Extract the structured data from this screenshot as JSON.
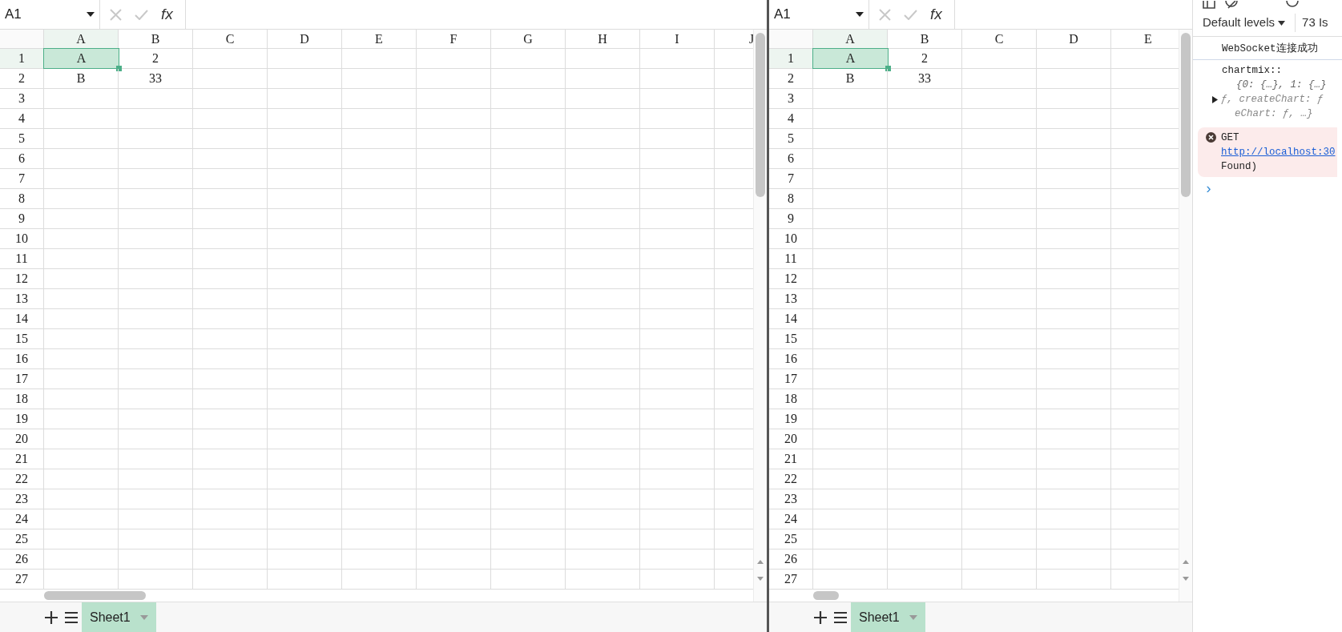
{
  "panes": [
    {
      "name_box": "A1",
      "function_label": "fx",
      "columns": [
        {
          "label": "A",
          "selected": true
        },
        {
          "label": "B",
          "selected": false
        },
        {
          "label": "C",
          "selected": false
        },
        {
          "label": "D",
          "selected": false
        },
        {
          "label": "E",
          "selected": false
        },
        {
          "label": "F",
          "selected": false
        },
        {
          "label": "G",
          "selected": false
        },
        {
          "label": "H",
          "selected": false
        },
        {
          "label": "I",
          "selected": false
        },
        {
          "label": "J",
          "selected": false
        }
      ],
      "rows": [
        {
          "number": "1",
          "selected": true,
          "cells": [
            {
              "text": "A",
              "selected": true
            },
            {
              "text": "2",
              "selected": false
            }
          ]
        },
        {
          "number": "2",
          "selected": false,
          "cells": [
            {
              "text": "B",
              "selected": false
            },
            {
              "text": "33",
              "selected": false
            }
          ]
        },
        {
          "number": "3",
          "selected": false
        },
        {
          "number": "4",
          "selected": false
        },
        {
          "number": "5",
          "selected": false
        },
        {
          "number": "6",
          "selected": false
        },
        {
          "number": "7",
          "selected": false
        },
        {
          "number": "8",
          "selected": false
        },
        {
          "number": "9",
          "selected": false
        },
        {
          "number": "10",
          "selected": false
        },
        {
          "number": "11",
          "selected": false
        },
        {
          "number": "12",
          "selected": false
        },
        {
          "number": "13",
          "selected": false
        },
        {
          "number": "14",
          "selected": false
        },
        {
          "number": "15",
          "selected": false
        },
        {
          "number": "16",
          "selected": false
        },
        {
          "number": "17",
          "selected": false
        },
        {
          "number": "18",
          "selected": false
        },
        {
          "number": "19",
          "selected": false
        },
        {
          "number": "20",
          "selected": false
        },
        {
          "number": "21",
          "selected": false
        },
        {
          "number": "22",
          "selected": false
        },
        {
          "number": "23",
          "selected": false
        },
        {
          "number": "24",
          "selected": false
        },
        {
          "number": "25",
          "selected": false
        },
        {
          "number": "26",
          "selected": false
        },
        {
          "number": "27",
          "selected": false
        }
      ],
      "sheet_tabs": [
        {
          "label": "Sheet1",
          "selected": true
        }
      ]
    },
    {
      "name_box": "A1",
      "function_label": "fx",
      "columns": [
        {
          "label": "A",
          "selected": true
        },
        {
          "label": "B",
          "selected": false
        },
        {
          "label": "C",
          "selected": false
        },
        {
          "label": "D",
          "selected": false
        },
        {
          "label": "E",
          "selected": false
        }
      ],
      "rows": [
        {
          "number": "1",
          "selected": true,
          "cells": [
            {
              "text": "A",
              "selected": true
            },
            {
              "text": "2",
              "selected": false
            }
          ]
        },
        {
          "number": "2",
          "selected": false,
          "cells": [
            {
              "text": "B",
              "selected": false
            },
            {
              "text": "33",
              "selected": false
            }
          ]
        },
        {
          "number": "3",
          "selected": false
        },
        {
          "number": "4",
          "selected": false
        },
        {
          "number": "5",
          "selected": false
        },
        {
          "number": "6",
          "selected": false
        },
        {
          "number": "7",
          "selected": false
        },
        {
          "number": "8",
          "selected": false
        },
        {
          "number": "9",
          "selected": false
        },
        {
          "number": "10",
          "selected": false
        },
        {
          "number": "11",
          "selected": false
        },
        {
          "number": "12",
          "selected": false
        },
        {
          "number": "13",
          "selected": false
        },
        {
          "number": "14",
          "selected": false
        },
        {
          "number": "15",
          "selected": false
        },
        {
          "number": "16",
          "selected": false
        },
        {
          "number": "17",
          "selected": false
        },
        {
          "number": "18",
          "selected": false
        },
        {
          "number": "19",
          "selected": false
        },
        {
          "number": "20",
          "selected": false
        },
        {
          "number": "21",
          "selected": false
        },
        {
          "number": "22",
          "selected": false
        },
        {
          "number": "23",
          "selected": false
        },
        {
          "number": "24",
          "selected": false
        },
        {
          "number": "25",
          "selected": false
        },
        {
          "number": "26",
          "selected": false
        },
        {
          "number": "27",
          "selected": false
        }
      ],
      "sheet_tabs": [
        {
          "label": "Sheet1",
          "selected": true
        }
      ]
    }
  ],
  "devtools": {
    "levels": "Default levels",
    "issues": "73 Is",
    "messages": [
      {
        "kind": "log",
        "lines": [
          "WebSocket连接成功"
        ]
      },
      {
        "kind": "object",
        "lines": [
          "chartmix::",
          "{0: {…}, 1: {…}",
          "ƒ, createChart: ƒ",
          "eChart: ƒ, …}"
        ]
      },
      {
        "kind": "error",
        "lines": [
          "GET",
          "http://localhost:30",
          "Found)"
        ]
      }
    ],
    "prompt": "›"
  }
}
